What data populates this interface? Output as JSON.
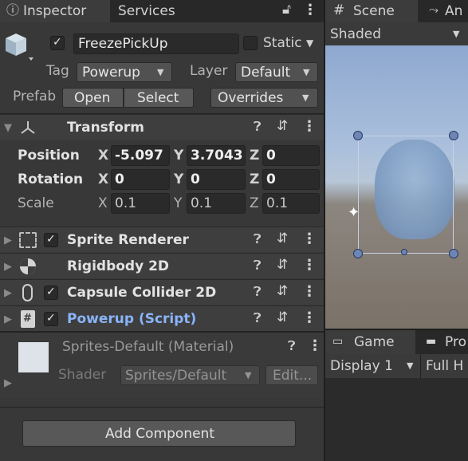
{
  "inspector": {
    "tab_label": "Inspector",
    "services_label": "Services",
    "object": {
      "name": "FreezePickUp",
      "static_label": "Static",
      "tag_label": "Tag",
      "tag_value": "Powerup",
      "layer_label": "Layer",
      "layer_value": "Default",
      "prefab_label": "Prefab",
      "open_label": "Open",
      "select_label": "Select",
      "overrides_label": "Overrides"
    },
    "transform": {
      "title": "Transform",
      "position_label": "Position",
      "rotation_label": "Rotation",
      "scale_label": "Scale",
      "x_label": "X",
      "y_label": "Y",
      "z_label": "Z",
      "position": {
        "x": "-5.097",
        "y": "3.7043",
        "z": "0"
      },
      "rotation": {
        "x": "0",
        "y": "0",
        "z": "0"
      },
      "scale": {
        "x": "0.1",
        "y": "0.1",
        "z": "0.1"
      }
    },
    "components": [
      {
        "title": "Sprite Renderer"
      },
      {
        "title": "Rigidbody 2D"
      },
      {
        "title": "Capsule Collider 2D"
      },
      {
        "title": "Powerup (Script)"
      }
    ],
    "material": {
      "title": "Sprites-Default (Material)",
      "shader_label": "Shader",
      "shader_value": "Sprites/Default",
      "edit_label": "Edit..."
    },
    "add_component_label": "Add Component"
  },
  "scene": {
    "tab_label": "Scene",
    "animator_tab_label": "An",
    "shading_label": "Shaded"
  },
  "game": {
    "tab_label": "Game",
    "project_tab_label": "Pro",
    "display_label": "Display 1",
    "resolution_label": "Full H"
  },
  "colors": {
    "script_title": "#8ab4f8",
    "sky_top": "#9db5d8",
    "ground": "#7b7268"
  }
}
